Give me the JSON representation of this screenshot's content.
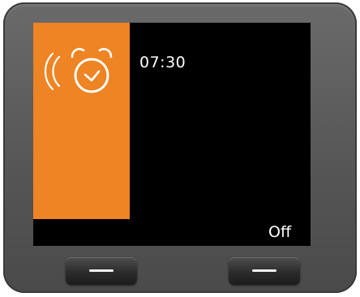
{
  "alarm": {
    "icon": "ringing-alarm-clock-icon",
    "time": "07:30",
    "panel_color": "#ee8424"
  },
  "softkeys": {
    "right_label": "Off",
    "left_label": ""
  }
}
